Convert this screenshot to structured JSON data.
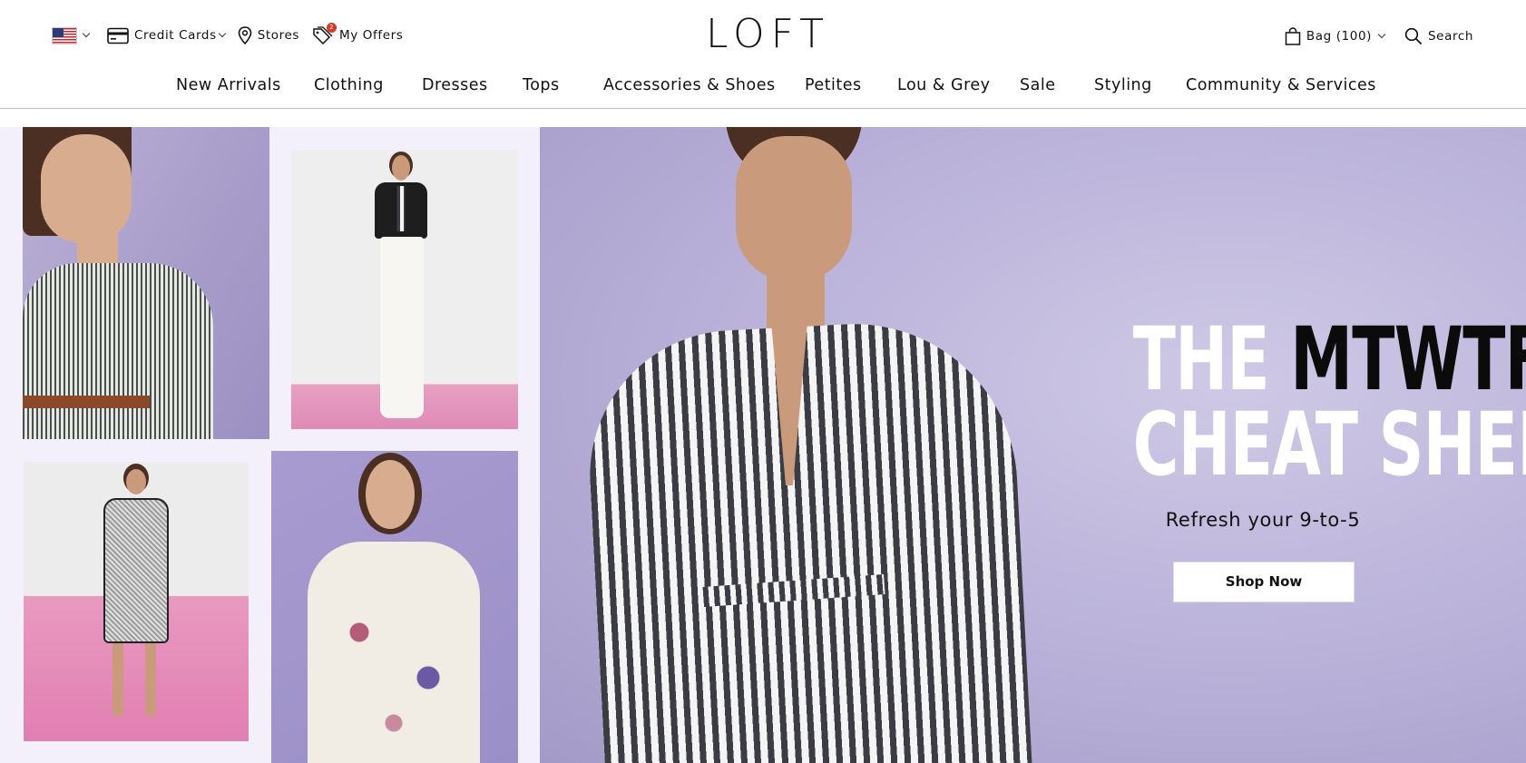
{
  "header": {
    "country_flag": "us-flag-icon",
    "credit_cards_label": "Credit Cards",
    "stores_label": "Stores",
    "offers_label": "My Offers",
    "offers_badge": "2",
    "logo_text": "LOFT",
    "bag_label": "Bag (100)",
    "search_label": "Search"
  },
  "nav": {
    "items": [
      "New Arrivals",
      "Clothing",
      "Dresses",
      "Tops",
      "Accessories & Shoes",
      "Petites",
      "Lou & Grey",
      "Sale",
      "Styling",
      "Community & Services"
    ]
  },
  "hero": {
    "headline_the": "THE",
    "headline_mtwtf": "MTWTF",
    "headline_line2": "CHEAT SHEET",
    "subheadline": "Refresh your 9-to-5",
    "cta_label": "Shop Now"
  },
  "colors": {
    "hero_background": "#f3f0fb",
    "panel_lavender": "#b8b0d8",
    "tile_pink": "#e17fb2",
    "offer_badge": "#d33a2c"
  }
}
